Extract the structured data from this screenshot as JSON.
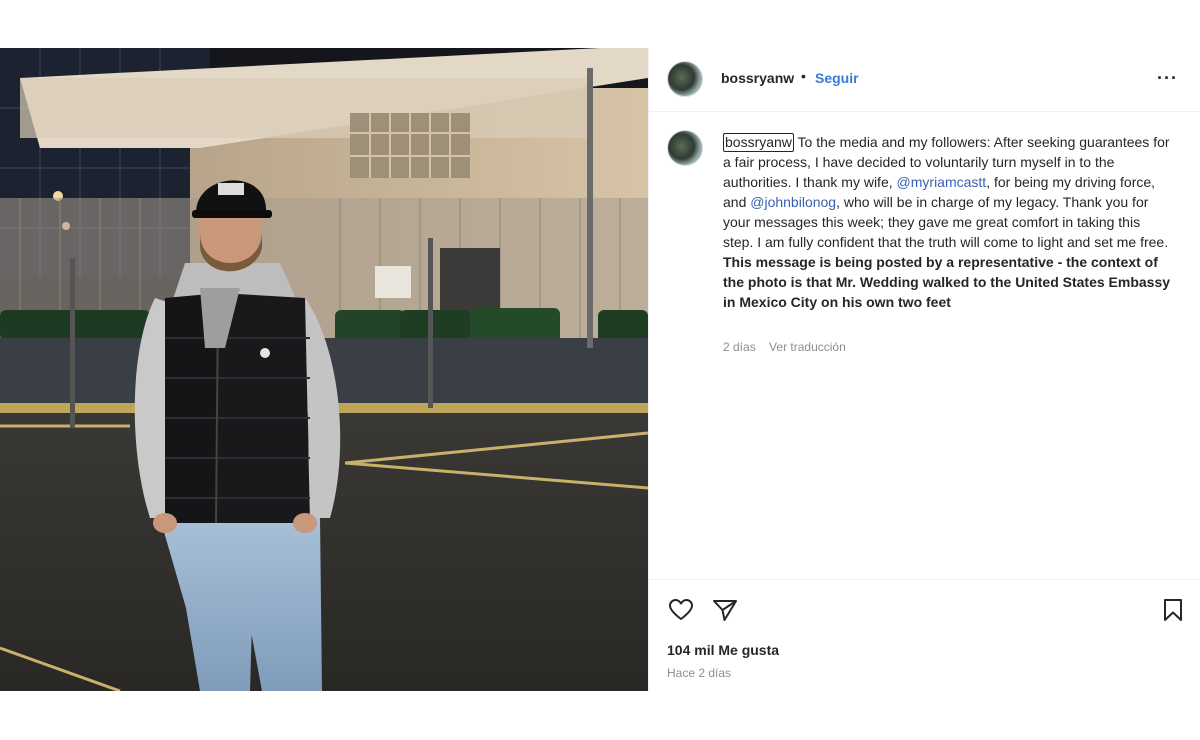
{
  "post": {
    "username": "bossryanw",
    "separator": "•",
    "follow_label": "Seguir",
    "more_label": "···"
  },
  "caption": {
    "username": "bossryanw",
    "text_1": " To the media and my followers: After seeking guarantees for a fair process, I have decided to voluntarily turn myself in to the authorities. I thank my wife, ",
    "mention_1": "@myriamcastt",
    "text_2": ", for being my driving force, and ",
    "mention_2": "@johnbilonog",
    "text_3": ", who will be in charge of my legacy. Thank you for your messages this week; they gave me great comfort in taking this step. I am fully confident that the truth will come to light and set me free.",
    "bold_text": "This message is being posted by a representative - the context of the photo is that Mr. Wedding walked to the United States Embassy in Mexico City on his own two feet",
    "age": "2 días",
    "translate_label": "Ver traducción"
  },
  "actions": {
    "likes": "104 mil Me gusta",
    "posted": "Hace 2 días"
  },
  "colors": {
    "accent": "#3a7bd5",
    "mention": "#3a5fb0",
    "muted": "#8e8e8e"
  },
  "icons": [
    "heart-icon",
    "share-icon",
    "bookmark-icon",
    "more-icon"
  ]
}
